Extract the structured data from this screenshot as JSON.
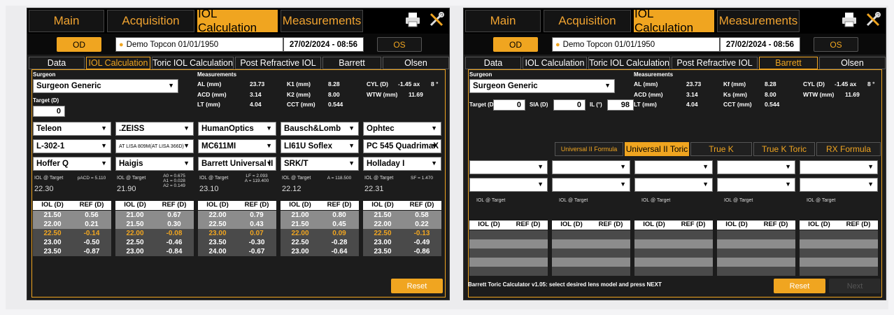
{
  "nav": {
    "main": "Main",
    "acquisition": "Acquisition",
    "iol_calculation": "IOL Calculation",
    "measurements": "Measurements"
  },
  "patient": {
    "od": "OD",
    "os": "OS",
    "name": "Demo Topcon 01/01/1950",
    "date": "27/02/2024 - 08:56"
  },
  "colors": {
    "accent": "#f0a520",
    "background": "#1c1c1c"
  },
  "icons": [
    "printer-icon",
    "tools-icon",
    "user-icon"
  ],
  "screenA": {
    "tabs": [
      "Data",
      "IOL Calculation",
      "Toric IOL Calculation",
      "Post Refractive IOL",
      "Barrett",
      "Olsen"
    ],
    "surgeon_label": "Surgeon",
    "surgeon": "Surgeon Generic",
    "target_label": "Target (D)",
    "target": "0",
    "measurements_label": "Measurements",
    "meas": {
      "al_l": "AL (mm)",
      "al_v": "23.73",
      "k1_l": "K1 (mm)",
      "k1_v": "8.28",
      "cyl_l": "CYL (D)",
      "cyl_v": "-1.45 ax",
      "cyl_ax": "8 °",
      "acd_l": "ACD (mm)",
      "acd_v": "3.14",
      "k2_l": "K2 (mm)",
      "k2_v": "8.00",
      "wtw_l": "WTW (mm)",
      "wtw_v": "11.69",
      "lt_l": "LT (mm)",
      "lt_v": "4.04",
      "cct_l": "CCT (mm)",
      "cct_v": "0.544"
    },
    "columns": [
      {
        "maker": "Teleon",
        "lens": "L-302-1",
        "formula": "Hoffer Q",
        "iol_target_label": "IOL @ Target",
        "const": "pACD = 5.110",
        "iol_target": "22.30",
        "rows": [
          [
            "21.50",
            "0.56"
          ],
          [
            "22.00",
            "0.21"
          ],
          [
            "22.50",
            "-0.14"
          ],
          [
            "23.00",
            "-0.50"
          ],
          [
            "23.50",
            "-0.87"
          ]
        ]
      },
      {
        "maker": ".ZEISS",
        "lens": "AT LISA 809M(AT LISA 366D)",
        "formula": "Haigis",
        "iol_target_label": "IOL @ Target",
        "const": "A0 = 0.675\nA1 = 0.028\nA2 = 0.149",
        "iol_target": "21.90",
        "rows": [
          [
            "21.00",
            "0.67"
          ],
          [
            "21.50",
            "0.30"
          ],
          [
            "22.00",
            "-0.08"
          ],
          [
            "22.50",
            "-0.46"
          ],
          [
            "23.00",
            "-0.84"
          ]
        ]
      },
      {
        "maker": "HumanOptics",
        "lens": "MC611MI",
        "formula": "Barrett Universal II",
        "iol_target_label": "IOL @ Target",
        "const": "LF = 2.093\nA = 119.400",
        "iol_target": "23.10",
        "rows": [
          [
            "22.00",
            "0.79"
          ],
          [
            "22.50",
            "0.43"
          ],
          [
            "23.00",
            "0.07"
          ],
          [
            "23.50",
            "-0.30"
          ],
          [
            "24.00",
            "-0.67"
          ]
        ]
      },
      {
        "maker": "Bausch&Lomb",
        "lens": "LI61U Soflex",
        "formula": "SRK/T",
        "iol_target_label": "IOL @ Target",
        "const": "A = 118.500",
        "iol_target": "22.12",
        "rows": [
          [
            "21.00",
            "0.80"
          ],
          [
            "21.50",
            "0.45"
          ],
          [
            "22.00",
            "0.09"
          ],
          [
            "22.50",
            "-0.28"
          ],
          [
            "23.00",
            "-0.64"
          ]
        ]
      },
      {
        "maker": "Ophtec",
        "lens": "PC 545 QuadrimaX",
        "formula": "Holladay I",
        "iol_target_label": "IOL @ Target",
        "const": "SF = 1.470",
        "iol_target": "22.31",
        "rows": [
          [
            "21.50",
            "0.58"
          ],
          [
            "22.00",
            "0.22"
          ],
          [
            "22.50",
            "-0.13"
          ],
          [
            "23.00",
            "-0.49"
          ],
          [
            "23.50",
            "-0.86"
          ]
        ]
      }
    ],
    "iol_header": "IOL (D)",
    "ref_header": "REF (D)",
    "reset": "Reset"
  },
  "screenB": {
    "tabs": [
      "Data",
      "IOL Calculation",
      "Toric IOL Calculation",
      "Post Refractive IOL",
      "Barrett",
      "Olsen"
    ],
    "surgeon_label": "Surgeon",
    "surgeon": "Surgeon Generic",
    "target_label": "Target (D)",
    "target": "0",
    "sia_label": "SIA (D)",
    "sia": "0",
    "il_label": "IL (°)",
    "il": "98",
    "measurements_label": "Measurements",
    "meas": {
      "al_l": "AL (mm)",
      "al_v": "23.73",
      "k1_l": "Kf (mm)",
      "k1_v": "8.28",
      "cyl_l": "CYL (D)",
      "cyl_v": "-1.45 ax",
      "cyl_ax": "8 °",
      "acd_l": "ACD (mm)",
      "acd_v": "3.14",
      "k2_l": "Ks (mm)",
      "k2_v": "8.00",
      "wtw_l": "WTW (mm)",
      "wtw_v": "11.69",
      "lt_l": "LT (mm)",
      "lt_v": "4.04",
      "cct_l": "CCT (mm)",
      "cct_v": "0.544"
    },
    "formula_tabs": [
      "Universal II Formula",
      "Universal II Toric",
      "True K",
      "True K Toric",
      "RX Formula"
    ],
    "iol_target_label": "IOL @ Target",
    "iol_header": "IOL (D)",
    "ref_header": "REF (D)",
    "status": "Barrett Toric Calculator v1.05: select desired lens model and press NEXT",
    "reset": "Reset",
    "next": "Next"
  }
}
